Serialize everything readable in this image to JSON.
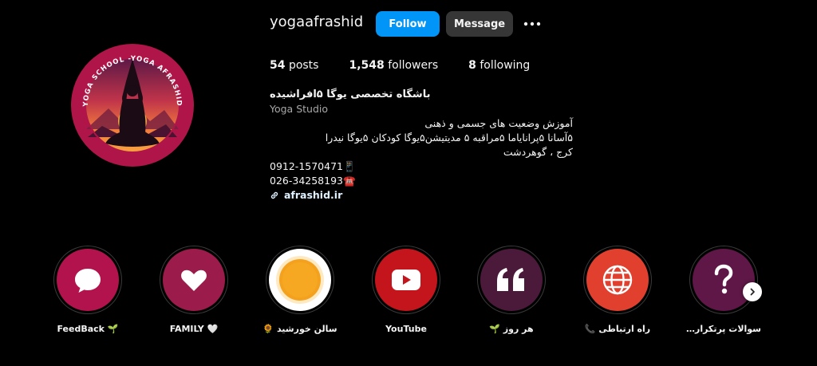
{
  "profile": {
    "username": "yogaafrashid",
    "follow_label": "Follow",
    "message_label": "Message",
    "avatar": {
      "ring_text_top": "YOGA SCHOOL -YOGA AFRASHID",
      "ring_text_bottom": "YOGA SCHOOL - YOGA AFRASHID"
    }
  },
  "stats": {
    "posts_count": "54",
    "posts_label": "posts",
    "followers_count": "1,548",
    "followers_label": "followers",
    "following_count": "8",
    "following_label": "following"
  },
  "bio": {
    "name": "باشگاه تخصصی یوگا ۵افراشیده",
    "category": "Yoga Studio",
    "line1": "آموزش وضعیت های جسمی و ذهنی",
    "line2": "۵آسانا ۵پرانایاما ۵مراقبه ۵ مدیتیشن۵یوگا کودکان ۵یوگا نیدرا",
    "line3": "کرج ، گوهردشت",
    "phone1": "0912-1570471📱",
    "phone2": "026-34258193☎️",
    "link": "afrashid.ir"
  },
  "highlights": [
    {
      "label": "FeedBack 🌱",
      "icon": "speech-bubble-icon",
      "bg": "#b3134d"
    },
    {
      "label": "FAMILY 🤍",
      "icon": "heart-icon",
      "bg": "#9b1b4a"
    },
    {
      "label": "سالن خورشید 🌻",
      "icon": "sun-icon",
      "bg": "#ffffff"
    },
    {
      "label": "YouTube",
      "icon": "youtube-icon",
      "bg": "#c4151c"
    },
    {
      "label": "هر روز 🌱",
      "icon": "quote-icon",
      "bg": "#4b1a3b"
    },
    {
      "label": "راه ارتباطی 📞",
      "icon": "globe-icon",
      "bg": "#e2402f"
    },
    {
      "label": "سوالات پرتکرار…",
      "icon": "question-icon",
      "bg": "#5e1746"
    }
  ],
  "colors": {
    "follow_blue": "#0095f6",
    "message_gray": "#363636",
    "avatar_ring": "#b0154a"
  }
}
